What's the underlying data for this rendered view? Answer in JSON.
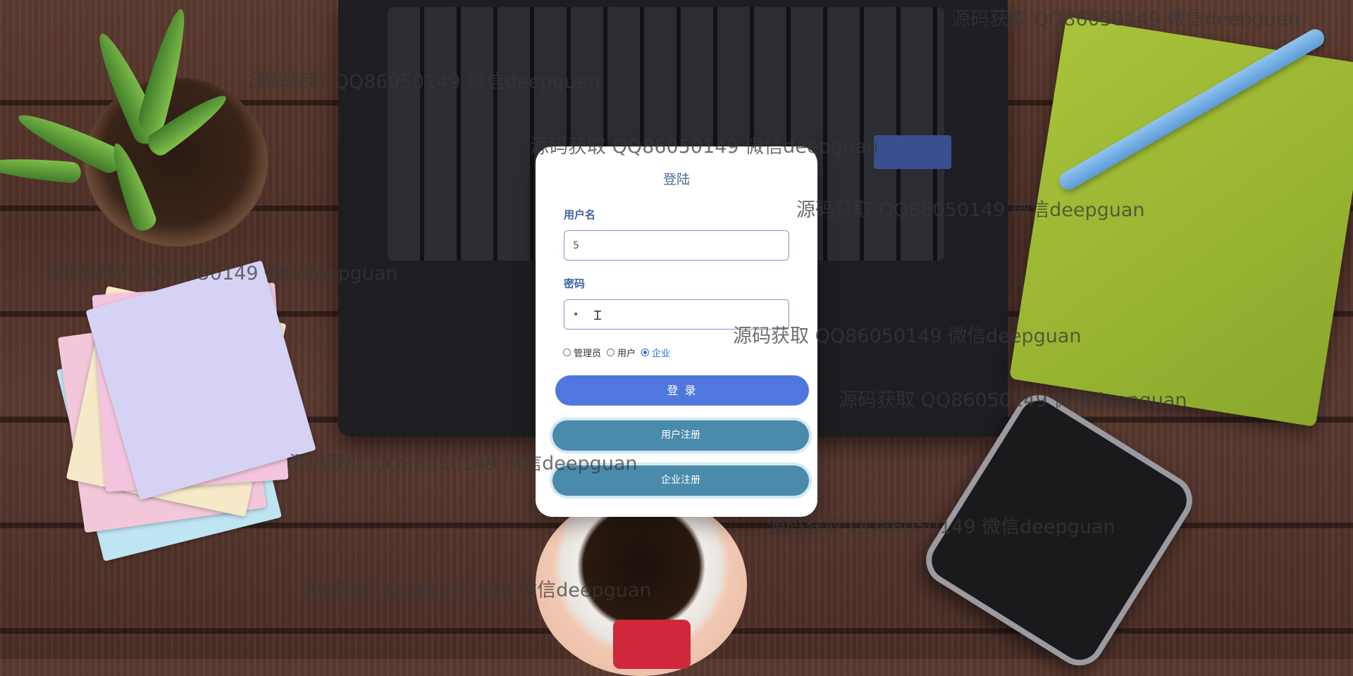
{
  "watermark": "源码获取 QQ86050149 微信deepguan",
  "login": {
    "title": "登陆",
    "username_label": "用户名",
    "username_value": "5",
    "password_label": "密码",
    "password_value": "•",
    "roles": [
      {
        "label": "管理员",
        "checked": false
      },
      {
        "label": "用户",
        "checked": false
      },
      {
        "label": "企业",
        "checked": true
      }
    ],
    "login_button": "登 录",
    "user_register_button": "用户注册",
    "company_register_button": "企业注册"
  },
  "colors": {
    "primary": "#4f77dd",
    "register": "#4a8aaa",
    "label": "#3e62a4",
    "radio_checked": "#2a68d8"
  }
}
